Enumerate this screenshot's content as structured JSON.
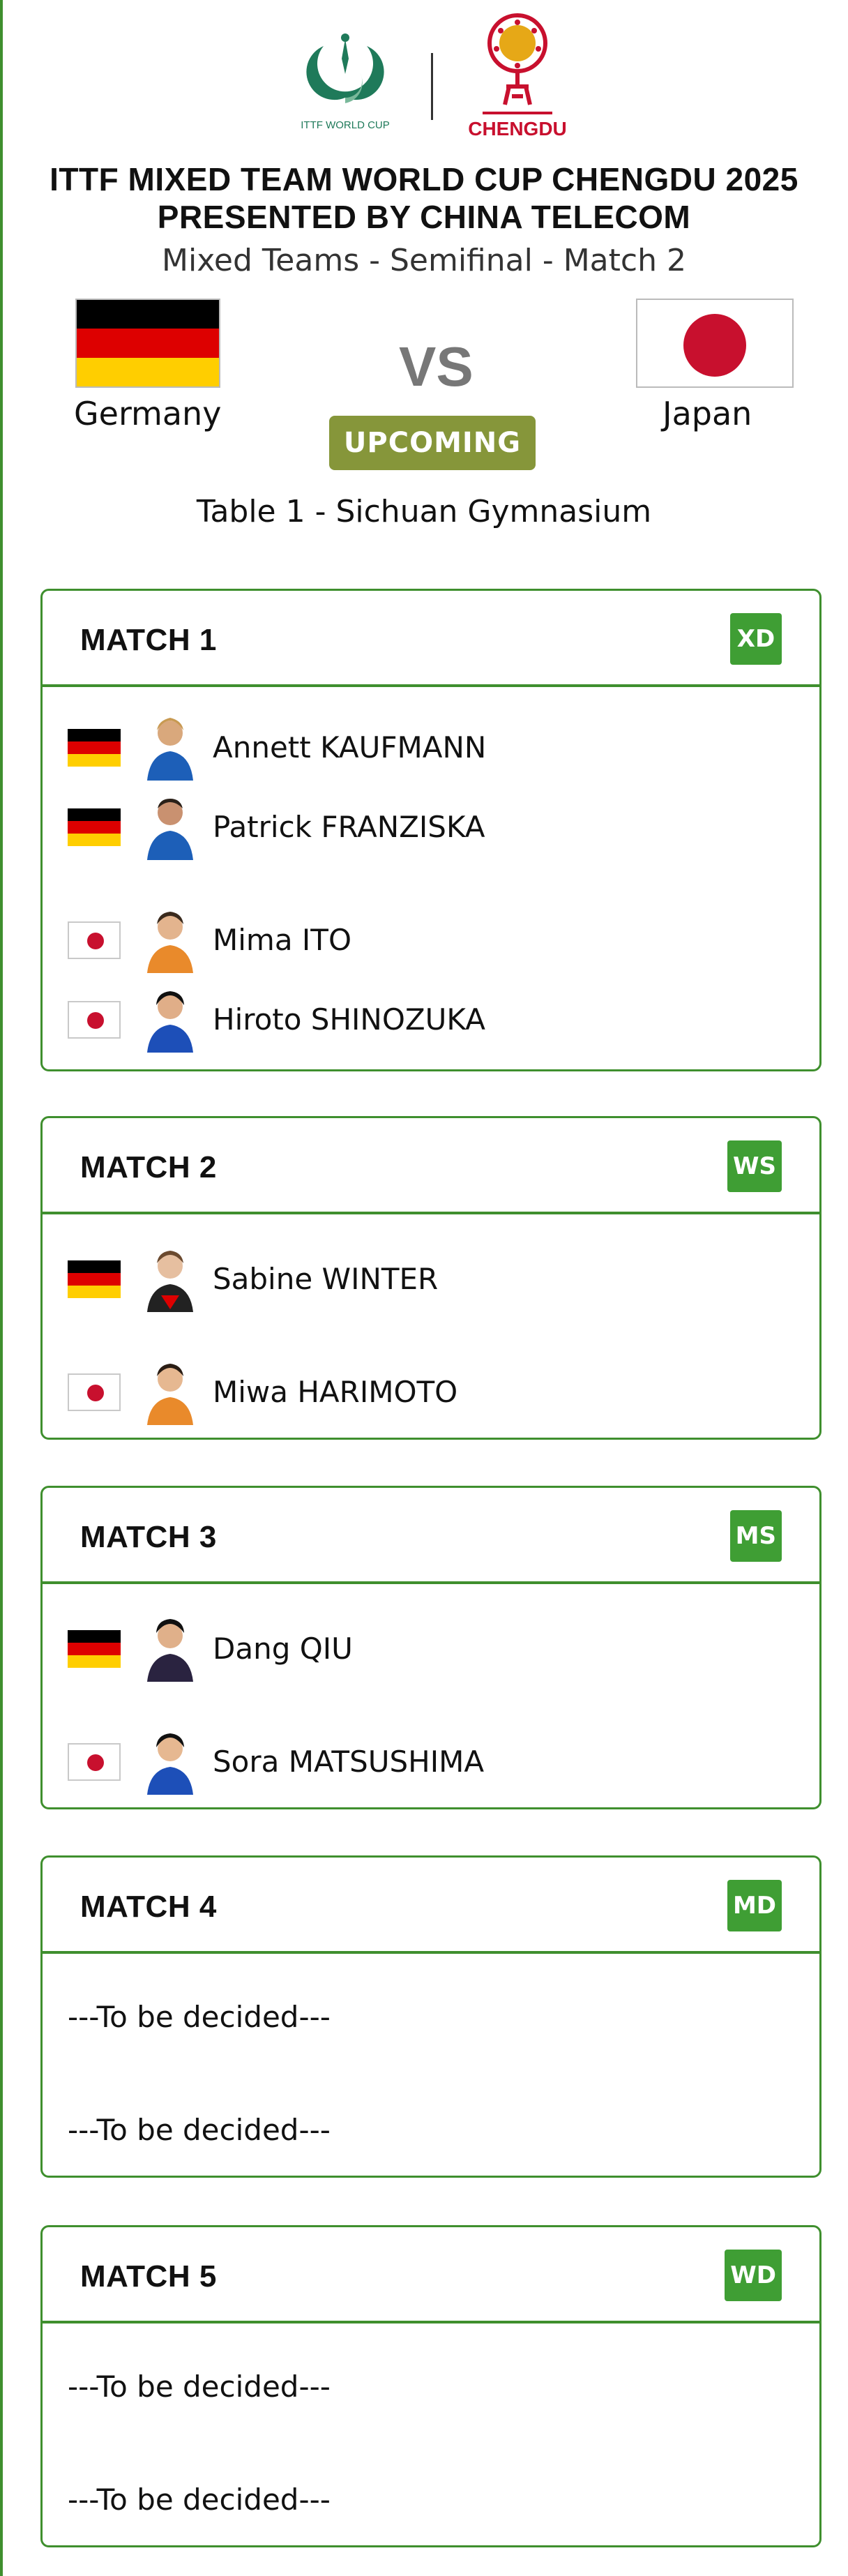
{
  "header": {
    "ittf_logo_text": "ITTF WORLD CUP",
    "chengdu_logo_text": "CHENGDU",
    "title_line1": "ITTF MIXED TEAM WORLD CUP CHENGDU 2025",
    "title_line2": "PRESENTED BY CHINA TELECOM",
    "subtitle": "Mixed Teams - Semifinal - Match 2"
  },
  "teams": {
    "home": "Germany",
    "away": "Japan",
    "vs": "VS",
    "status": "UPCOMING"
  },
  "venue": "Table 1 - Sichuan Gymnasium",
  "colors": {
    "accent_green": "#3f8f2e",
    "badge_green": "#3f9e34",
    "status_olive": "#86963a",
    "jp_red": "#c8102e"
  },
  "matches": [
    {
      "title": "MATCH 1",
      "badge": "XD",
      "players": [
        {
          "name": "Annett KAUFMANN",
          "country": "Germany"
        },
        {
          "name": "Patrick FRANZISKA",
          "country": "Germany"
        },
        {
          "name": "Mima ITO",
          "country": "Japan"
        },
        {
          "name": "Hiroto SHINOZUKA",
          "country": "Japan"
        }
      ]
    },
    {
      "title": "MATCH 2",
      "badge": "WS",
      "players": [
        {
          "name": "Sabine WINTER",
          "country": "Germany"
        },
        {
          "name": "Miwa HARIMOTO",
          "country": "Japan"
        }
      ]
    },
    {
      "title": "MATCH 3",
      "badge": "MS",
      "players": [
        {
          "name": "Dang QIU",
          "country": "Germany"
        },
        {
          "name": "Sora MATSUSHIMA",
          "country": "Japan"
        }
      ]
    },
    {
      "title": "MATCH 4",
      "badge": "MD",
      "tbd": [
        "---To be decided---",
        "---To be decided---"
      ]
    },
    {
      "title": "MATCH 5",
      "badge": "WD",
      "tbd": [
        "---To be decided---",
        "---To be decided---"
      ]
    }
  ]
}
